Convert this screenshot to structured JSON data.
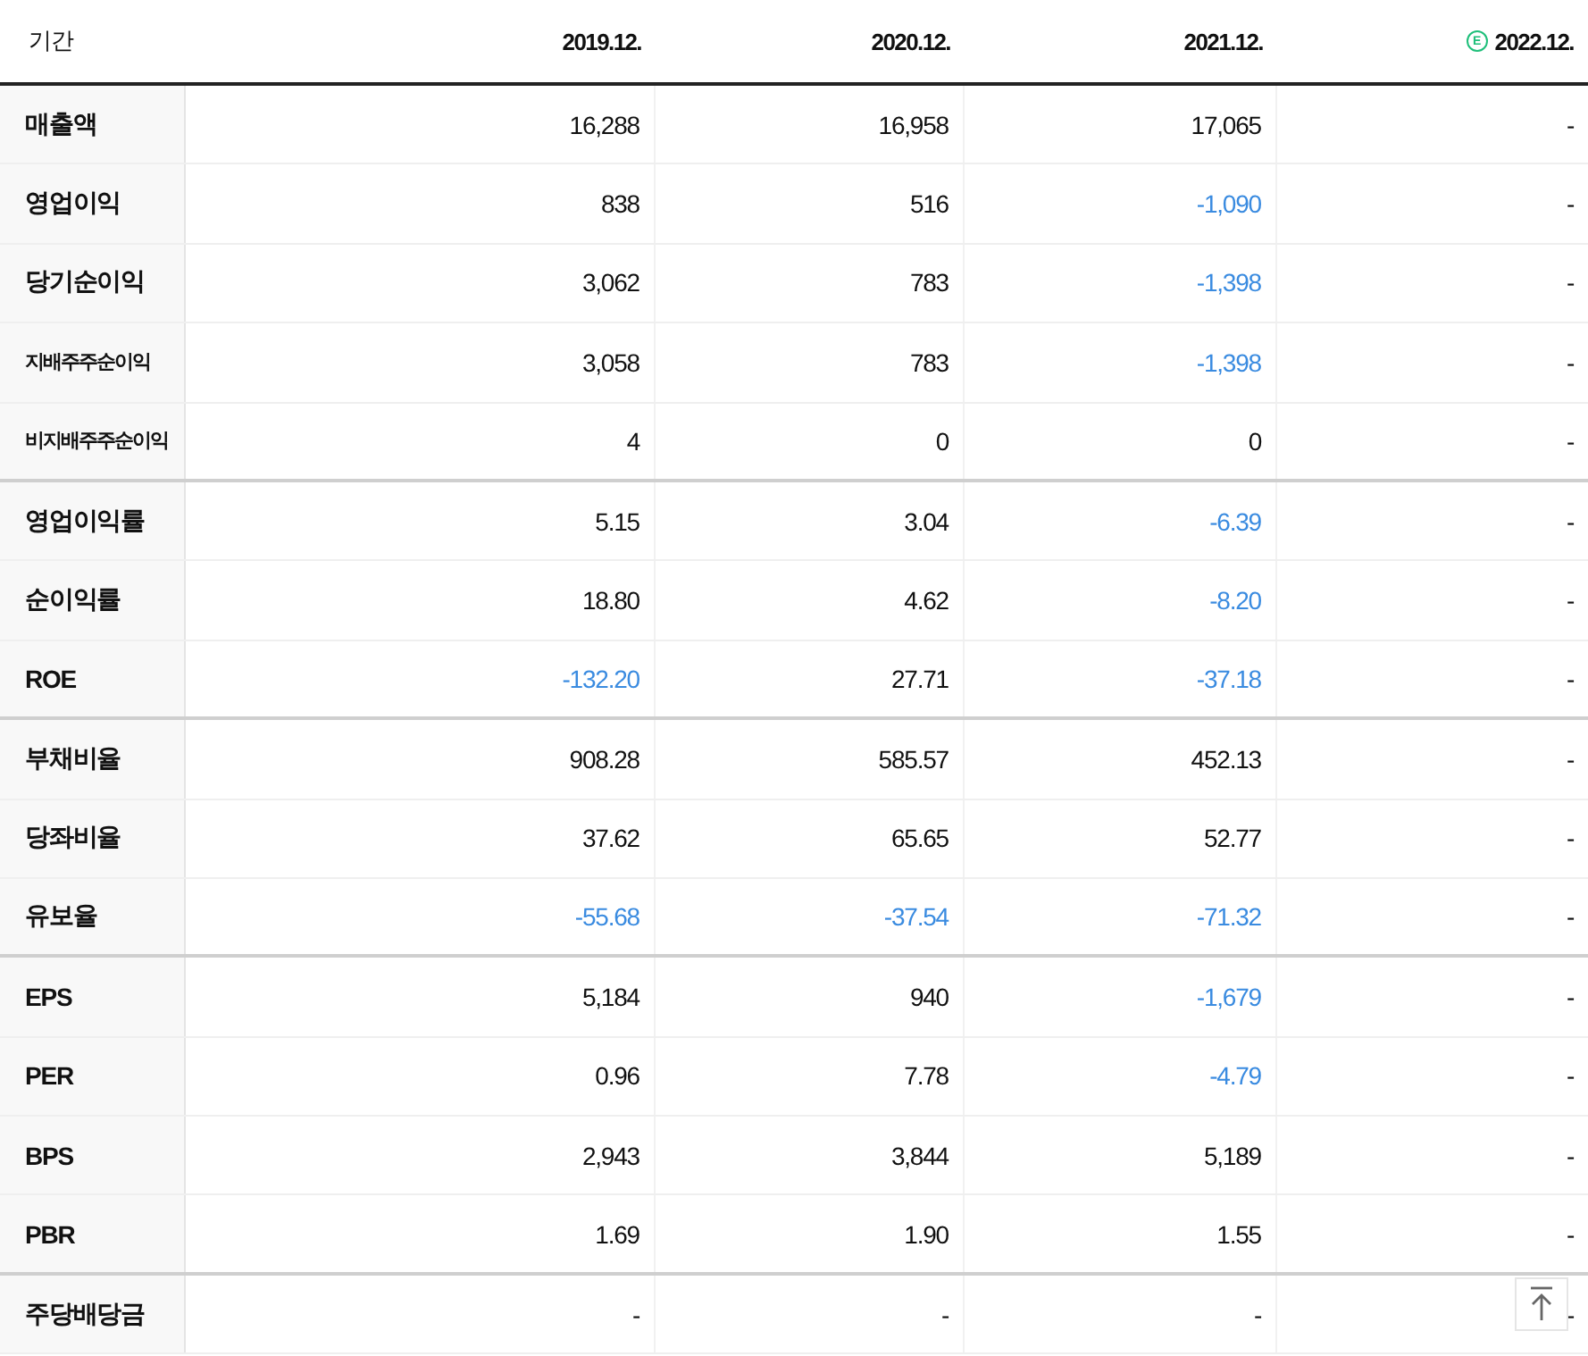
{
  "header": {
    "label": "기간",
    "columns": [
      {
        "text": "2019.12.",
        "estimate": false
      },
      {
        "text": "2020.12.",
        "estimate": false
      },
      {
        "text": "2021.12.",
        "estimate": false
      },
      {
        "text": "2022.12.",
        "estimate": true,
        "badge": "E"
      }
    ]
  },
  "rows": [
    {
      "label": "매출액",
      "group_end": false,
      "cells": [
        {
          "text": "16,288",
          "negative": false
        },
        {
          "text": "16,958",
          "negative": false
        },
        {
          "text": "17,065",
          "negative": false
        },
        {
          "text": "-",
          "negative": false
        }
      ]
    },
    {
      "label": "영업이익",
      "group_end": false,
      "cells": [
        {
          "text": "838",
          "negative": false
        },
        {
          "text": "516",
          "negative": false
        },
        {
          "text": "-1,090",
          "negative": true
        },
        {
          "text": "-",
          "negative": false
        }
      ]
    },
    {
      "label": "당기순이익",
      "group_end": false,
      "cells": [
        {
          "text": "3,062",
          "negative": false
        },
        {
          "text": "783",
          "negative": false
        },
        {
          "text": "-1,398",
          "negative": true
        },
        {
          "text": "-",
          "negative": false
        }
      ]
    },
    {
      "label": "지배주주순이익",
      "group_end": false,
      "cells": [
        {
          "text": "3,058",
          "negative": false
        },
        {
          "text": "783",
          "negative": false
        },
        {
          "text": "-1,398",
          "negative": true
        },
        {
          "text": "-",
          "negative": false
        }
      ]
    },
    {
      "label": "비지배주주순이익",
      "group_end": true,
      "cells": [
        {
          "text": "4",
          "negative": false
        },
        {
          "text": "0",
          "negative": false
        },
        {
          "text": "0",
          "negative": false
        },
        {
          "text": "-",
          "negative": false
        }
      ]
    },
    {
      "label": "영업이익률",
      "group_end": false,
      "cells": [
        {
          "text": "5.15",
          "negative": false
        },
        {
          "text": "3.04",
          "negative": false
        },
        {
          "text": "-6.39",
          "negative": true
        },
        {
          "text": "-",
          "negative": false
        }
      ]
    },
    {
      "label": "순이익률",
      "group_end": false,
      "cells": [
        {
          "text": "18.80",
          "negative": false
        },
        {
          "text": "4.62",
          "negative": false
        },
        {
          "text": "-8.20",
          "negative": true
        },
        {
          "text": "-",
          "negative": false
        }
      ]
    },
    {
      "label": "ROE",
      "group_end": true,
      "cells": [
        {
          "text": "-132.20",
          "negative": true
        },
        {
          "text": "27.71",
          "negative": false
        },
        {
          "text": "-37.18",
          "negative": true
        },
        {
          "text": "-",
          "negative": false
        }
      ]
    },
    {
      "label": "부채비율",
      "group_end": false,
      "cells": [
        {
          "text": "908.28",
          "negative": false
        },
        {
          "text": "585.57",
          "negative": false
        },
        {
          "text": "452.13",
          "negative": false
        },
        {
          "text": "-",
          "negative": false
        }
      ]
    },
    {
      "label": "당좌비율",
      "group_end": false,
      "cells": [
        {
          "text": "37.62",
          "negative": false
        },
        {
          "text": "65.65",
          "negative": false
        },
        {
          "text": "52.77",
          "negative": false
        },
        {
          "text": "-",
          "negative": false
        }
      ]
    },
    {
      "label": "유보율",
      "group_end": true,
      "cells": [
        {
          "text": "-55.68",
          "negative": true
        },
        {
          "text": "-37.54",
          "negative": true
        },
        {
          "text": "-71.32",
          "negative": true
        },
        {
          "text": "-",
          "negative": false
        }
      ]
    },
    {
      "label": "EPS",
      "group_end": false,
      "cells": [
        {
          "text": "5,184",
          "negative": false
        },
        {
          "text": "940",
          "negative": false
        },
        {
          "text": "-1,679",
          "negative": true
        },
        {
          "text": "-",
          "negative": false
        }
      ]
    },
    {
      "label": "PER",
      "group_end": false,
      "cells": [
        {
          "text": "0.96",
          "negative": false
        },
        {
          "text": "7.78",
          "negative": false
        },
        {
          "text": "-4.79",
          "negative": true
        },
        {
          "text": "-",
          "negative": false
        }
      ]
    },
    {
      "label": "BPS",
      "group_end": false,
      "cells": [
        {
          "text": "2,943",
          "negative": false
        },
        {
          "text": "3,844",
          "negative": false
        },
        {
          "text": "5,189",
          "negative": false
        },
        {
          "text": "-",
          "negative": false
        }
      ]
    },
    {
      "label": "PBR",
      "group_end": true,
      "cells": [
        {
          "text": "1.69",
          "negative": false
        },
        {
          "text": "1.90",
          "negative": false
        },
        {
          "text": "1.55",
          "negative": false
        },
        {
          "text": "-",
          "negative": false
        }
      ]
    },
    {
      "label": "주당배당금",
      "group_end": false,
      "cells": [
        {
          "text": "-",
          "negative": false
        },
        {
          "text": "-",
          "negative": false
        },
        {
          "text": "-",
          "negative": false
        },
        {
          "text": "-",
          "negative": false
        }
      ]
    }
  ]
}
